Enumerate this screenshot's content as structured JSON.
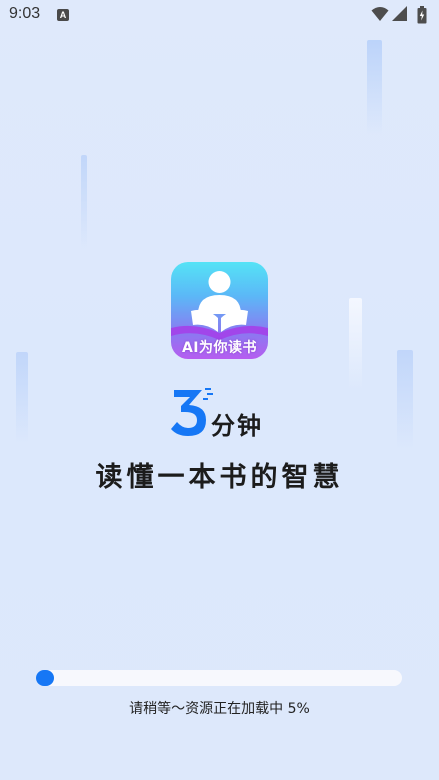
{
  "status_bar": {
    "time": "9:03",
    "app_icon_letter": "A",
    "icons": [
      "wifi-icon",
      "signal-icon",
      "battery-icon"
    ]
  },
  "logo": {
    "text": "AI为你读书",
    "colors": {
      "gradient_top": "#55e3f6",
      "gradient_bottom": "#b65df0"
    }
  },
  "slogan": {
    "number": "3",
    "unit": "分钟",
    "main": "读懂一本书的智慧",
    "number_color": "#1677f5"
  },
  "loading": {
    "text": "请稍等～资源正在加载中 5%",
    "progress": 0.05,
    "bar_color": "#1677f5",
    "track_color": "#f7f8fd"
  }
}
